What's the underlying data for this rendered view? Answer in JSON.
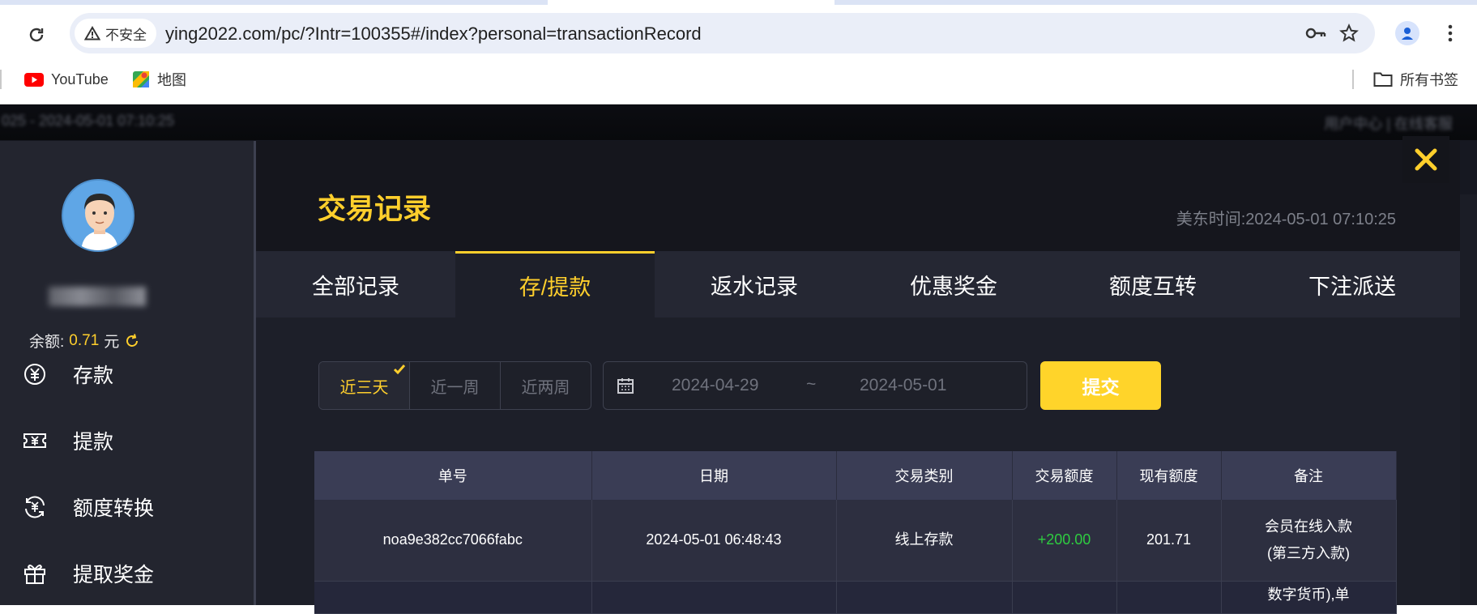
{
  "browser": {
    "security_label": "不安全",
    "url": "ying2022.com/pc/?Intr=100355#/index?personal=transactionRecord",
    "bookmarks": [
      {
        "label": "YouTube",
        "icon": "youtube-icon"
      },
      {
        "label": "地图",
        "icon": "maps-icon"
      }
    ],
    "all_bookmarks_label": "所有书签"
  },
  "background_strip": {
    "left_text": "025 - 2024-05-01 07:10:25",
    "right_text": "用户中心 | 在线客服"
  },
  "sidebar": {
    "balance_label": "余额:",
    "balance_value": "0.71",
    "balance_unit": "元",
    "items": [
      {
        "label": "存款",
        "icon": "yuan-circle-icon"
      },
      {
        "label": "提款",
        "icon": "withdraw-ticket-icon"
      },
      {
        "label": "额度转换",
        "icon": "exchange-yuan-icon"
      },
      {
        "label": "提取奖金",
        "icon": "gift-icon"
      }
    ]
  },
  "panel": {
    "title": "交易记录",
    "est_time_label": "美东时间:",
    "est_time_value": "2024-05-01 07:10:25",
    "tabs": [
      {
        "label": "全部记录",
        "active": false
      },
      {
        "label": "存/提款",
        "active": true
      },
      {
        "label": "返水记录",
        "active": false
      },
      {
        "label": "优惠奖金",
        "active": false
      },
      {
        "label": "额度互转",
        "active": false
      },
      {
        "label": "下注派送",
        "active": false
      }
    ],
    "ranges": [
      {
        "label": "近三天",
        "active": true
      },
      {
        "label": "近一周",
        "active": false
      },
      {
        "label": "近两周",
        "active": false
      }
    ],
    "date_from": "2024-04-29",
    "date_separator": "~",
    "date_to": "2024-05-01",
    "submit_label": "提交"
  },
  "table": {
    "headers": [
      "单号",
      "日期",
      "交易类别",
      "交易额度",
      "现有额度",
      "备注"
    ],
    "rows": [
      [
        "noa9e382cc7066fabc",
        "2024-05-01 06:48:43",
        "线上存款",
        "+200.00",
        "201.71",
        "会员在线入款(第三方入款)"
      ],
      [
        "",
        "",
        "",
        "",
        "",
        "数字货币),单"
      ]
    ]
  },
  "colors": {
    "accent": "#ffcf2c",
    "positive": "#2ecc40",
    "panel_bg": "#1d1f29"
  }
}
